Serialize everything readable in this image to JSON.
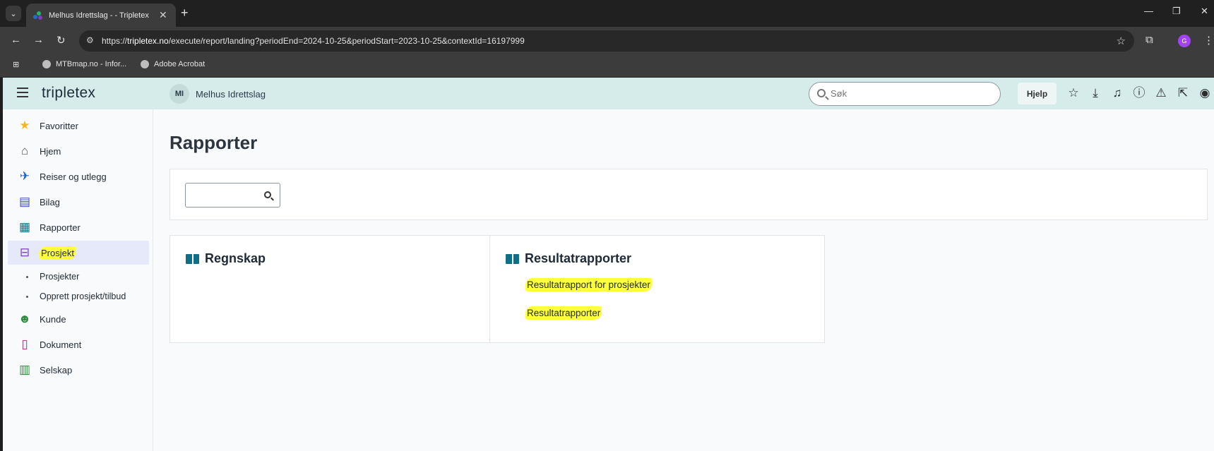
{
  "browser": {
    "tab_title": "Melhus Idrettslag - - Tripletex",
    "url_prefix": "https://",
    "url_domain": "tripletex.no",
    "url_path": "/execute/report/landing?periodEnd=2024-10-25&periodStart=2023-10-25&contextId=16197999",
    "bookmarks": [
      "MTBmap.no - Infor...",
      "Adobe Acrobat"
    ],
    "profile_initial": "G"
  },
  "app": {
    "logo": "tripletex",
    "company_initials": "MI",
    "company_name": "Melhus Idrettslag",
    "search_placeholder": "Søk",
    "help_label": "Hjelp"
  },
  "sidebar": {
    "items": [
      {
        "label": "Favoritter",
        "icon": "star-icon"
      },
      {
        "label": "Hjem",
        "icon": "home-icon"
      },
      {
        "label": "Reiser og utlegg",
        "icon": "plane-icon"
      },
      {
        "label": "Bilag",
        "icon": "document-list-icon"
      },
      {
        "label": "Rapporter",
        "icon": "dashboard-icon"
      },
      {
        "label": "Prosjekt",
        "icon": "briefcase-icon"
      },
      {
        "label": "Kunde",
        "icon": "people-icon"
      },
      {
        "label": "Dokument",
        "icon": "file-icon"
      },
      {
        "label": "Selskap",
        "icon": "building-icon"
      }
    ],
    "sub_items": [
      "Prosjekter",
      "Opprett prosjekt/tilbud"
    ]
  },
  "main": {
    "title": "Rapporter",
    "cards": [
      {
        "title": "Regnskap",
        "links": []
      },
      {
        "title": "Resultatrapporter",
        "links": [
          "Resultatrapport for prosjekter",
          "Resultatrapporter"
        ]
      }
    ]
  },
  "colors": {
    "topbar": "#d6ecea",
    "active_nav": "#e6e9f9",
    "highlight": "#ffff3a",
    "book_icon": "#0e6f87"
  }
}
